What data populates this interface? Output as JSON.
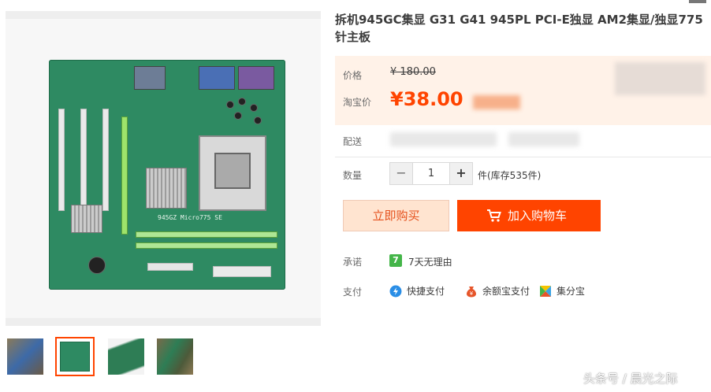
{
  "product": {
    "title": "拆机945GC集显 G31 G41 945PL PCI-E独显 AM2集显/独显775针主板",
    "board_silkscreen": "945GZ Micro775 SE"
  },
  "price": {
    "label": "价格",
    "original": "¥ 180.00",
    "taobao_label": "淘宝价",
    "taobao_price": "¥38.00"
  },
  "delivery": {
    "label": "配送"
  },
  "quantity": {
    "label": "数量",
    "minus": "−",
    "value": "1",
    "plus": "+",
    "stock": "件(库存535件)"
  },
  "buttons": {
    "buy_now": "立即购买",
    "add_cart": "加入购物车"
  },
  "promise": {
    "label": "承诺",
    "badge": "7",
    "text": "7天无理由"
  },
  "payment": {
    "label": "支付",
    "methods": [
      {
        "name": "快捷支付",
        "icon": "quick-pay-icon",
        "color": "#2a8ee6"
      },
      {
        "name": "余额宝支付",
        "icon": "yuebao-icon",
        "color": "#e6552a"
      },
      {
        "name": "集分宝",
        "icon": "jifenbao-icon",
        "color": "#3aa4e6"
      }
    ]
  },
  "colors": {
    "accent": "#ff4400",
    "price_bg": "#fff2e8",
    "buy_now_bg": "#ffe4d0"
  },
  "watermark": "头条号 / 晨光之际"
}
